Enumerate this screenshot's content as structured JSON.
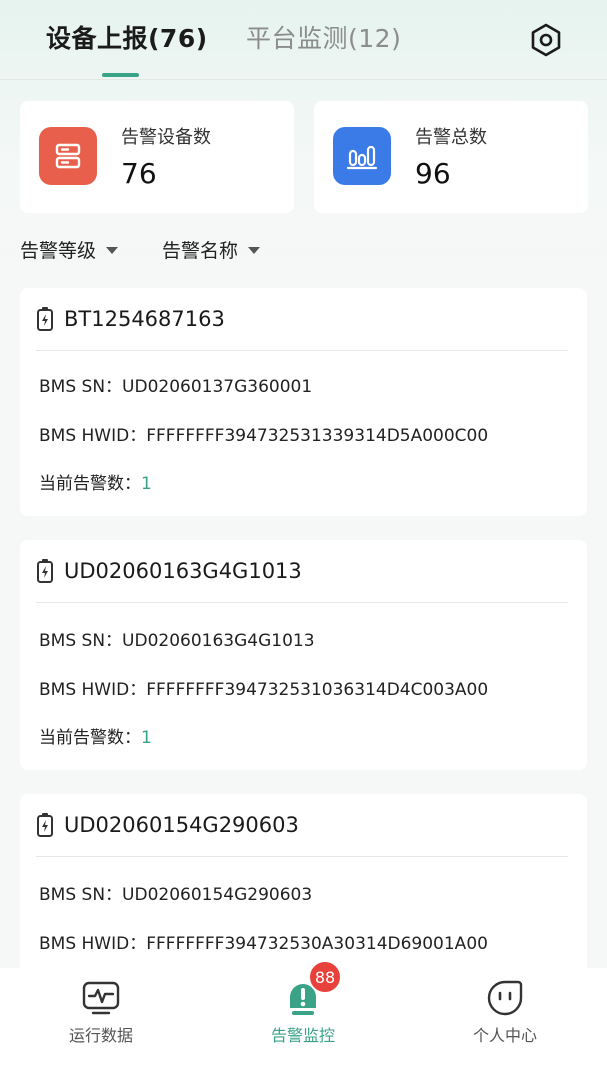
{
  "header": {
    "tabs": [
      {
        "label": "设备上报(76)",
        "active": true
      },
      {
        "label": "平台监测(12)",
        "active": false
      }
    ],
    "settings_icon": "settings-hex-icon"
  },
  "stats": {
    "alarm_devices": {
      "label": "告警设备数",
      "value": "76",
      "icon": "server-icon",
      "color": "#e8604c"
    },
    "alarm_total": {
      "label": "告警总数",
      "value": "96",
      "icon": "bar-chart-icon",
      "color": "#3b7be8"
    }
  },
  "filters": [
    {
      "label": "告警等级",
      "icon": "caret-down-icon"
    },
    {
      "label": "告警名称",
      "icon": "caret-down-icon"
    }
  ],
  "devices": [
    {
      "title": "BT1254687163",
      "sn_label": "BMS SN：",
      "sn": "UD02060137G360001",
      "hwid_label": "BMS HWID：",
      "hwid": "FFFFFFFF394732531339314D5A000C00",
      "alarm_label": "当前告警数：",
      "alarm_count": "1"
    },
    {
      "title": "UD02060163G4G1013",
      "sn_label": "BMS SN：",
      "sn": "UD02060163G4G1013",
      "hwid_label": "BMS HWID：",
      "hwid": "FFFFFFFF394732531036314D4C003A00",
      "alarm_label": "当前告警数：",
      "alarm_count": "1"
    },
    {
      "title": "UD02060154G290603",
      "sn_label": "BMS SN：",
      "sn": "UD02060154G290603",
      "hwid_label": "BMS HWID：",
      "hwid": "FFFFFFFF394732530A30314D69001A00"
    }
  ],
  "bottom_nav": {
    "items": [
      {
        "label": "运行数据",
        "icon": "monitor-pulse-icon",
        "active": false
      },
      {
        "label": "告警监控",
        "icon": "alarm-light-icon",
        "active": true,
        "badge": "88"
      },
      {
        "label": "个人中心",
        "icon": "face-icon",
        "active": false
      }
    ]
  },
  "colors": {
    "accent": "#3aa387",
    "badge": "#e8403b",
    "server_icon_bg": "#e8604c",
    "chart_icon_bg": "#3b7be8"
  }
}
